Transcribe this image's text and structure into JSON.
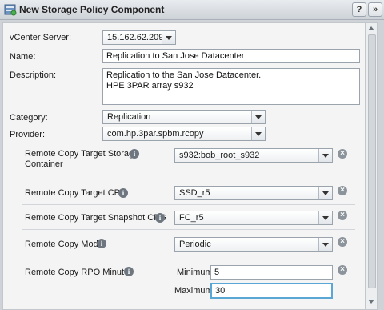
{
  "window": {
    "title": "New Storage Policy Component",
    "help": "?",
    "expand": "»"
  },
  "form": {
    "vcenter": {
      "label": "vCenter Server:",
      "value": "15.162.62.209"
    },
    "name": {
      "label": "Name:",
      "value": "Replication to San Jose Datacenter"
    },
    "description": {
      "label": "Description:",
      "lines": [
        "Replication to the San Jose Datacenter.",
        "HPE 3PAR array s932"
      ]
    },
    "category": {
      "label": "Category:",
      "value": "Replication"
    },
    "provider": {
      "label": "Provider:",
      "value": "com.hp.3par.spbm.rcopy"
    }
  },
  "rules": [
    {
      "label_lines": [
        "Remote Copy Target Storage",
        "Container"
      ],
      "value": "s932:bob_root_s932"
    },
    {
      "label_lines": [
        "Remote Copy Target CPG"
      ],
      "value": "SSD_r5"
    },
    {
      "label_lines": [
        "Remote Copy Target Snapshot CPG"
      ],
      "value": "FC_r5"
    },
    {
      "label_lines": [
        "Remote Copy Mode"
      ],
      "value": "Periodic"
    }
  ],
  "rpo": {
    "label": "Remote Copy RPO Minutes",
    "minimum_label": "Minimum:",
    "minimum": "5",
    "maximum_label": "Maximum:",
    "maximum": "30"
  },
  "icons": {
    "info": "i",
    "remove": "×"
  }
}
